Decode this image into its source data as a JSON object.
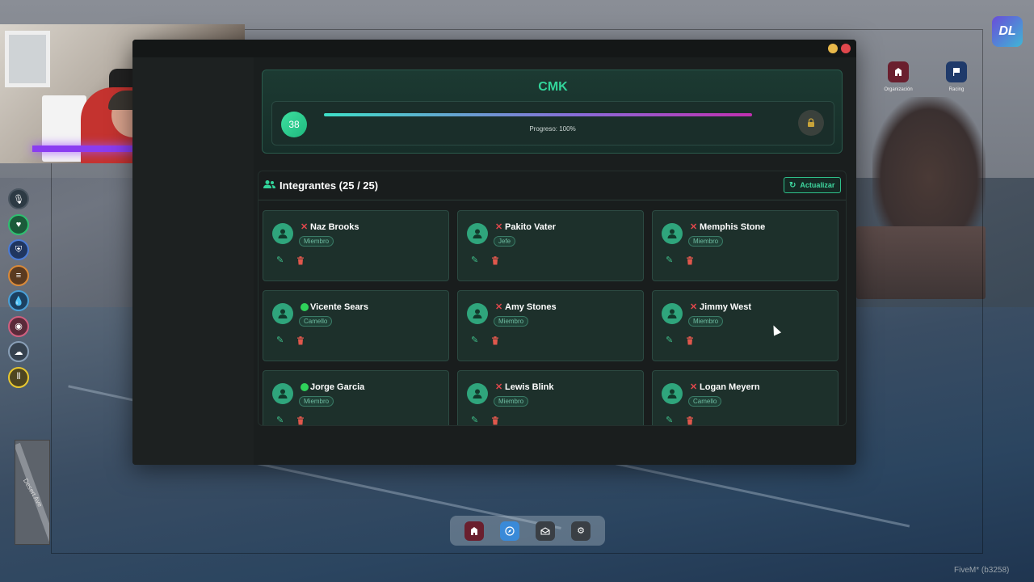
{
  "background": {
    "minimap_street": "Desert Ave"
  },
  "hud": {
    "items": [
      {
        "name": "voice-icon",
        "glyph": "🎙"
      },
      {
        "name": "health-icon",
        "glyph": "♥"
      },
      {
        "name": "armor-icon",
        "glyph": "⛨"
      },
      {
        "name": "food-icon",
        "glyph": "≡"
      },
      {
        "name": "water-icon",
        "glyph": "💧"
      },
      {
        "name": "stress-icon",
        "glyph": "◉"
      },
      {
        "name": "lungs-icon",
        "glyph": "☁"
      },
      {
        "name": "mic-level-icon",
        "glyph": "⦀"
      }
    ]
  },
  "top_apps": [
    {
      "label": "Organización",
      "icon": "building-icon",
      "color": "#6a1f2e"
    },
    {
      "label": "Racing",
      "icon": "flag-icon",
      "color": "#1f3a6a"
    }
  ],
  "window": {
    "org_name": "CMK",
    "level": "38",
    "progress_label": "Progreso: 100%",
    "progress_fraction": 1.0,
    "members_title": "Integrantes (25 / 25)",
    "refresh_label": "Actualizar"
  },
  "members": [
    {
      "name": "Naz Brooks",
      "rank": "Miembro",
      "online": false
    },
    {
      "name": "Pakito Vater",
      "rank": "Jefe",
      "online": false
    },
    {
      "name": "Memphis Stone",
      "rank": "Miembro",
      "online": false
    },
    {
      "name": "Vicente Sears",
      "rank": "Camello",
      "online": true
    },
    {
      "name": "Amy Stones",
      "rank": "Miembro",
      "online": false
    },
    {
      "name": "Jimmy West",
      "rank": "Miembro",
      "online": false
    },
    {
      "name": "Jorge Garcia",
      "rank": "Miembro",
      "online": true
    },
    {
      "name": "Lewis Blink",
      "rank": "Miembro",
      "online": false
    },
    {
      "name": "Logan Meyern",
      "rank": "Camello",
      "online": false
    }
  ],
  "dock": [
    {
      "icon": "building-icon",
      "color": "#6a1f2e"
    },
    {
      "icon": "compass-icon",
      "color": "#3a8ad8"
    },
    {
      "icon": "mail-icon",
      "color": "#3a3f45"
    },
    {
      "icon": "settings-icon",
      "color": "#3a3f45"
    }
  ],
  "footer": {
    "client_label": "FiveM* (b3258)"
  },
  "colors": {
    "accent": "#32d49a",
    "offline": "#e0474c",
    "online": "#2fd15a"
  }
}
